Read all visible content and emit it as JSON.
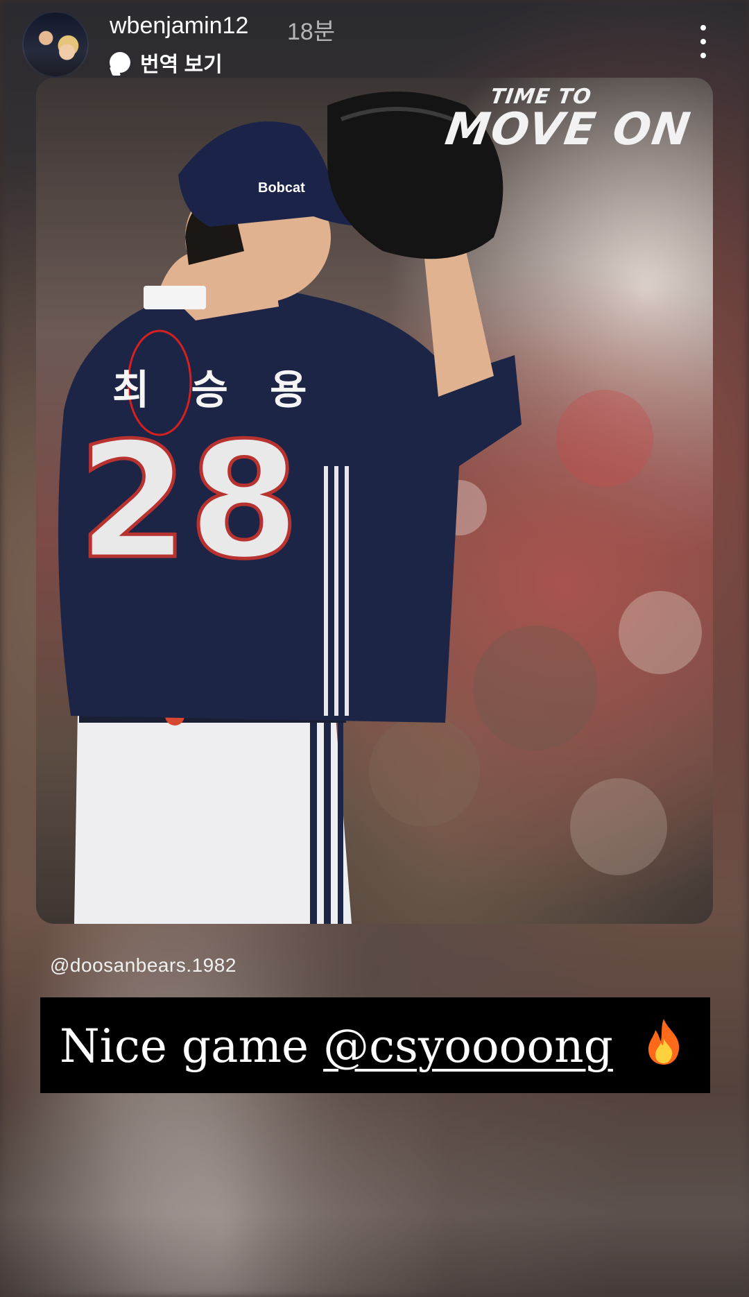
{
  "header": {
    "username": "wbenjamin12",
    "time_ago": "18분",
    "translate_label": "번역 보기",
    "more_icon": "more-vertical-icon"
  },
  "story": {
    "overlay_brand_line1": "TIME TO",
    "overlay_brand_line2": "MOVE ON",
    "jersey_name": "최 승 용",
    "jersey_number": "28",
    "cap_logo": "Bobcat",
    "credit": "@doosanbears.1982",
    "caption_prefix": "Nice game ",
    "caption_mention": "@csyoooong",
    "caption_emoji_icon": "fire-icon"
  },
  "colors": {
    "jersey_navy": "#1d2547",
    "caption_bg": "#000000",
    "text": "#ffffff"
  }
}
